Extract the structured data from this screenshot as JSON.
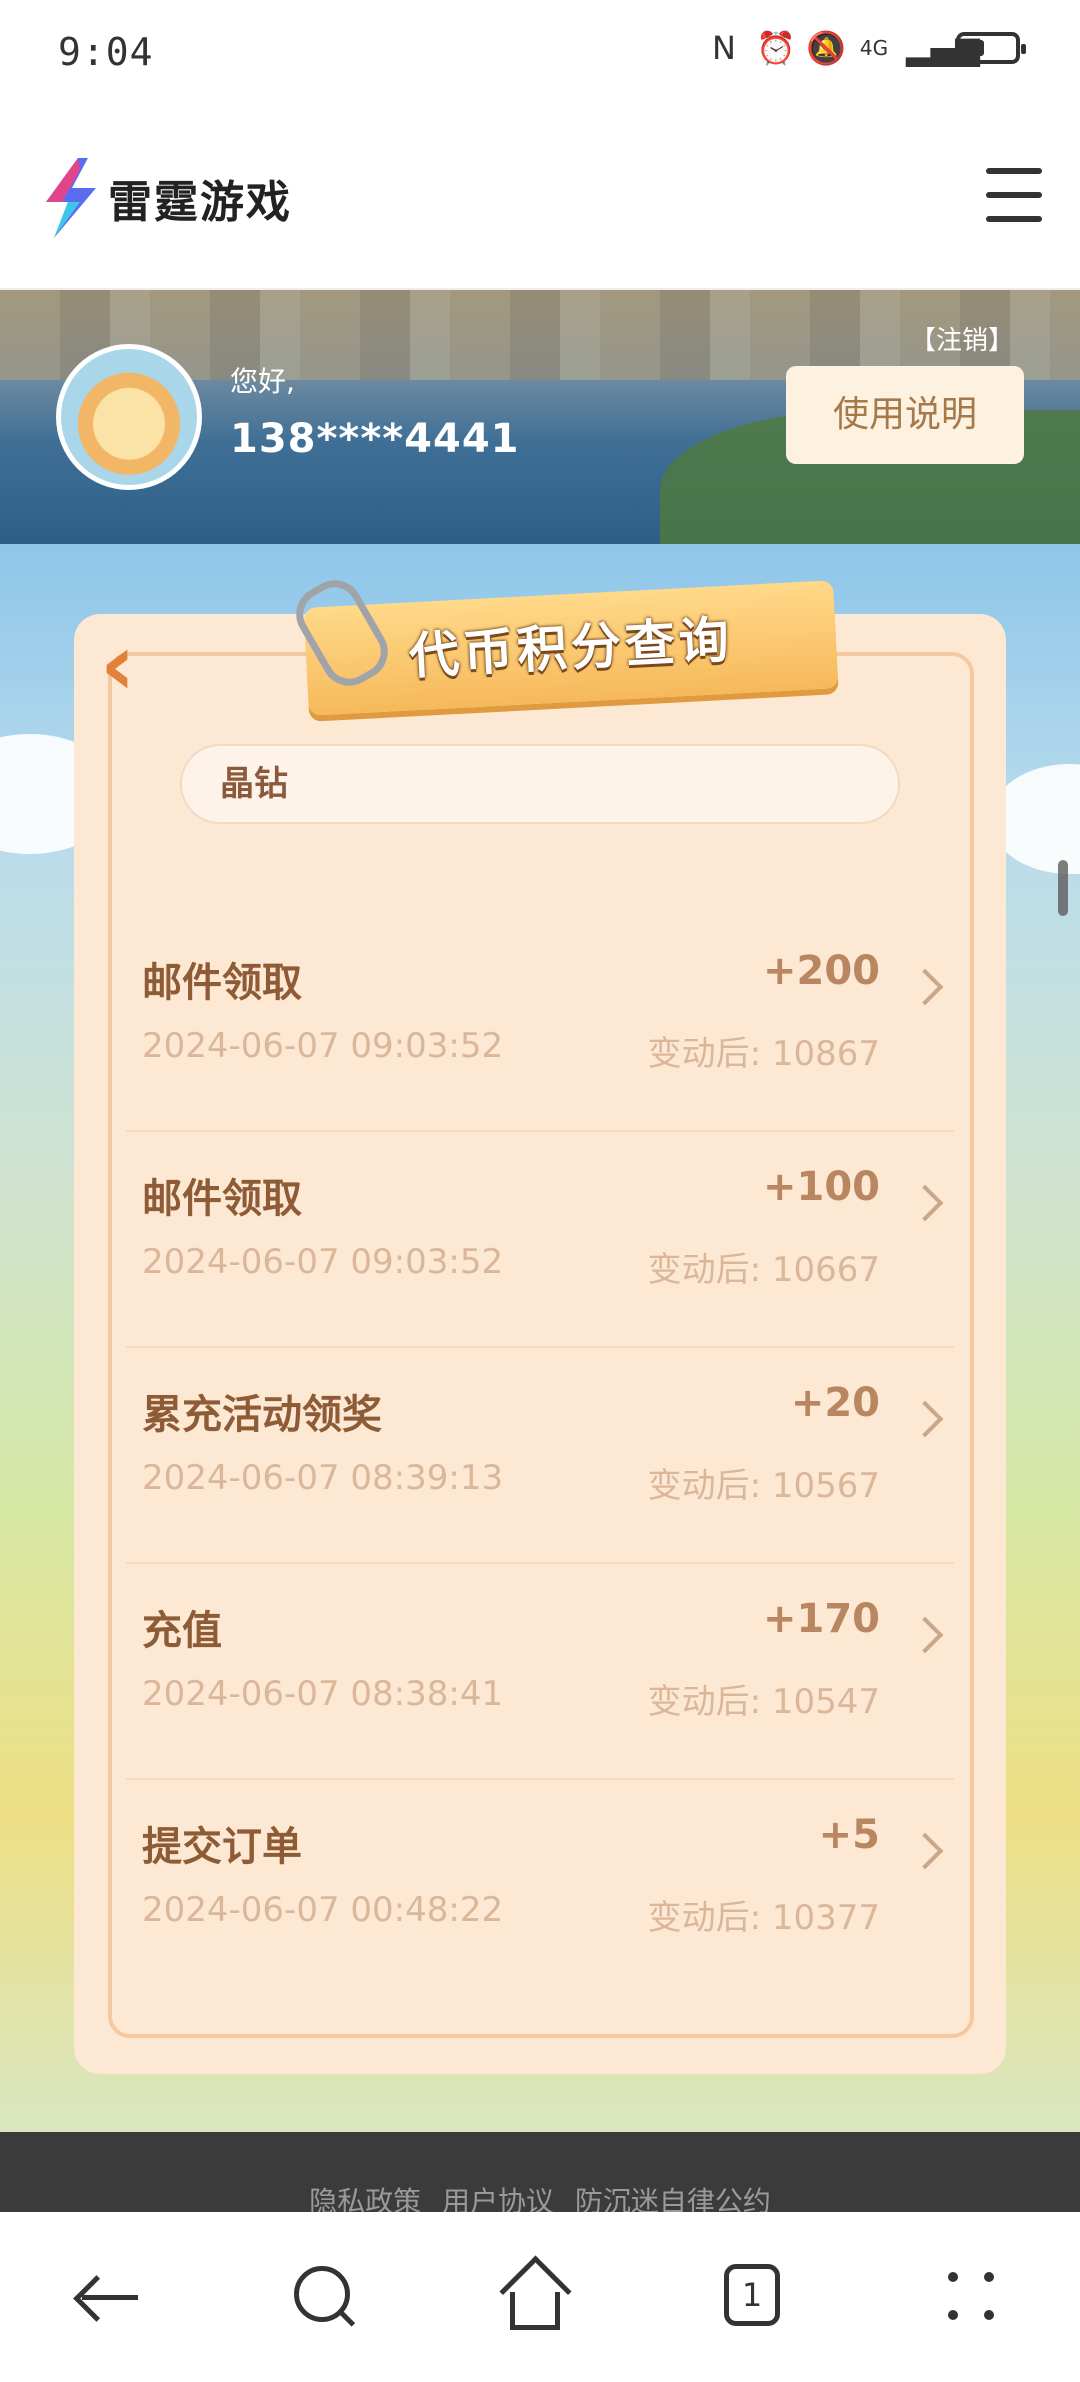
{
  "status_bar": {
    "time": "9:04",
    "network": "4G",
    "icons": [
      "nfc-icon",
      "alarm-icon",
      "mute-icon",
      "signal-icon",
      "battery-icon"
    ]
  },
  "header": {
    "logo_text": "雷霆游戏",
    "menu_icon": "hamburger-menu-icon"
  },
  "user": {
    "greeting": "您好,",
    "phone": "138****4441",
    "logout_label": "【注销】",
    "guide_label": "使用说明"
  },
  "panel": {
    "title": "代币积分查询",
    "currency": "晶钻",
    "records": [
      {
        "title": "邮件领取",
        "amount": "+200",
        "time": "2024-06-07 09:03:52",
        "after": "变动后:  10867"
      },
      {
        "title": "邮件领取",
        "amount": "+100",
        "time": "2024-06-07 09:03:52",
        "after": "变动后:  10667"
      },
      {
        "title": "累充活动领奖",
        "amount": "+20",
        "time": "2024-06-07 08:39:13",
        "after": "变动后:  10567"
      },
      {
        "title": "充值",
        "amount": "+170",
        "time": "2024-06-07 08:38:41",
        "after": "变动后:  10547"
      },
      {
        "title": "提交订单",
        "amount": "+5",
        "time": "2024-06-07 00:48:22",
        "after": "变动后:  10377"
      }
    ]
  },
  "footer": {
    "links": [
      "隐私政策",
      "用户协议",
      "防沉迷自律公约"
    ]
  },
  "bottom_nav": {
    "tab_count": "1"
  },
  "colors": {
    "accent": "#e0823a",
    "panel_bg": "#fde8d4",
    "text_brown": "#8d5b35"
  }
}
